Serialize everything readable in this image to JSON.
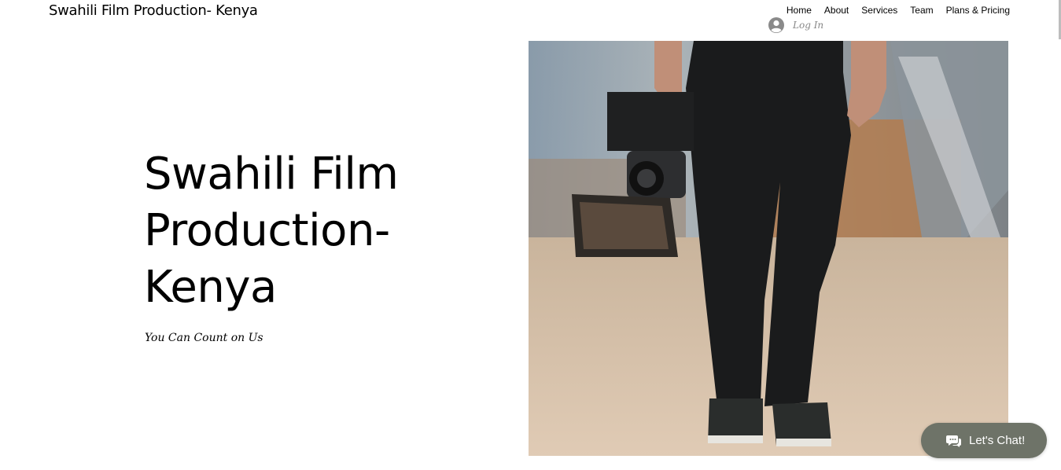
{
  "header": {
    "site_title": "Swahili Film Production- Kenya",
    "nav": [
      "Home",
      "About",
      "Services",
      "Team",
      "Plans & Pricing"
    ],
    "login_label": "Log In"
  },
  "hero": {
    "title": "Swahili Film\nProduction-\nKenya",
    "subtitle": "You Can Count on Us"
  },
  "chat": {
    "label": "Let's Chat!",
    "icon": "chat-bubbles-icon"
  },
  "colors": {
    "chat_background": "#6e7368",
    "login_label": "#888888",
    "sand": "#d9c3ab"
  }
}
